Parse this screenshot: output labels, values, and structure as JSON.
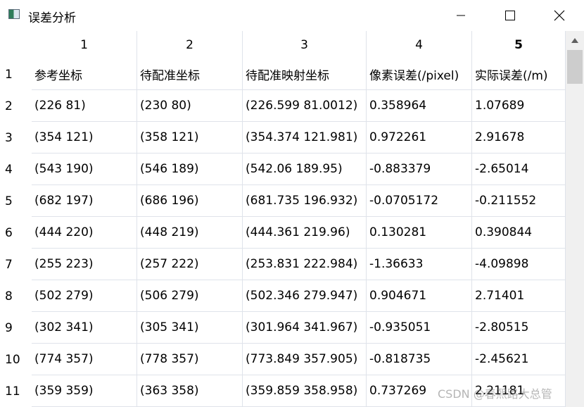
{
  "window": {
    "title": "误差分析"
  },
  "table": {
    "column_headers": [
      "1",
      "2",
      "3",
      "4",
      "5"
    ],
    "rows": [
      {
        "label": "1",
        "cells": [
          "参考坐标",
          "待配准坐标",
          "待配准映射坐标",
          "像素误差(/pixel)",
          "实际误差(/m)"
        ]
      },
      {
        "label": "2",
        "cells": [
          "(226 81)",
          "(230 80)",
          "(226.599 81.0012)",
          "0.358964",
          "1.07689"
        ]
      },
      {
        "label": "3",
        "cells": [
          "(354 121)",
          "(358 121)",
          "(354.374 121.981)",
          "0.972261",
          "2.91678"
        ]
      },
      {
        "label": "4",
        "cells": [
          "(543 190)",
          "(546 189)",
          "(542.06 189.95)",
          "-0.883379",
          "-2.65014"
        ]
      },
      {
        "label": "5",
        "cells": [
          "(682 197)",
          "(686 196)",
          "(681.735 196.932)",
          "-0.0705172",
          "-0.211552"
        ]
      },
      {
        "label": "6",
        "cells": [
          "(444 220)",
          "(448 219)",
          "(444.361 219.96)",
          "0.130281",
          "0.390844"
        ]
      },
      {
        "label": "7",
        "cells": [
          "(255 223)",
          "(257 222)",
          "(253.831 222.984)",
          "-1.36633",
          "-4.09898"
        ]
      },
      {
        "label": "8",
        "cells": [
          "(502 279)",
          "(506 279)",
          "(502.346 279.947)",
          "0.904671",
          "2.71401"
        ]
      },
      {
        "label": "9",
        "cells": [
          "(302 341)",
          "(305 341)",
          "(301.964 341.967)",
          "-0.935051",
          "-2.80515"
        ]
      },
      {
        "label": "10",
        "cells": [
          "(774 357)",
          "(778 357)",
          "(773.849 357.905)",
          "-0.818735",
          "-2.45621"
        ]
      },
      {
        "label": "11",
        "cells": [
          "(359 359)",
          "(363 358)",
          "(359.859 358.958)",
          "0.737269",
          "2.21181"
        ]
      }
    ]
  },
  "watermark": "CSDN @春熙路大总管"
}
